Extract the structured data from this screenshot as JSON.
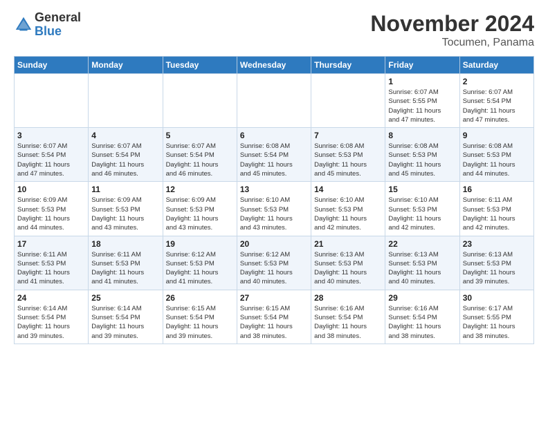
{
  "header": {
    "logo_line1": "General",
    "logo_line2": "Blue",
    "month_title": "November 2024",
    "location": "Tocumen, Panama"
  },
  "days_of_week": [
    "Sunday",
    "Monday",
    "Tuesday",
    "Wednesday",
    "Thursday",
    "Friday",
    "Saturday"
  ],
  "weeks": [
    [
      {
        "day": "",
        "content": ""
      },
      {
        "day": "",
        "content": ""
      },
      {
        "day": "",
        "content": ""
      },
      {
        "day": "",
        "content": ""
      },
      {
        "day": "",
        "content": ""
      },
      {
        "day": "1",
        "content": "Sunrise: 6:07 AM\nSunset: 5:55 PM\nDaylight: 11 hours\nand 47 minutes."
      },
      {
        "day": "2",
        "content": "Sunrise: 6:07 AM\nSunset: 5:54 PM\nDaylight: 11 hours\nand 47 minutes."
      }
    ],
    [
      {
        "day": "3",
        "content": "Sunrise: 6:07 AM\nSunset: 5:54 PM\nDaylight: 11 hours\nand 47 minutes."
      },
      {
        "day": "4",
        "content": "Sunrise: 6:07 AM\nSunset: 5:54 PM\nDaylight: 11 hours\nand 46 minutes."
      },
      {
        "day": "5",
        "content": "Sunrise: 6:07 AM\nSunset: 5:54 PM\nDaylight: 11 hours\nand 46 minutes."
      },
      {
        "day": "6",
        "content": "Sunrise: 6:08 AM\nSunset: 5:54 PM\nDaylight: 11 hours\nand 45 minutes."
      },
      {
        "day": "7",
        "content": "Sunrise: 6:08 AM\nSunset: 5:53 PM\nDaylight: 11 hours\nand 45 minutes."
      },
      {
        "day": "8",
        "content": "Sunrise: 6:08 AM\nSunset: 5:53 PM\nDaylight: 11 hours\nand 45 minutes."
      },
      {
        "day": "9",
        "content": "Sunrise: 6:08 AM\nSunset: 5:53 PM\nDaylight: 11 hours\nand 44 minutes."
      }
    ],
    [
      {
        "day": "10",
        "content": "Sunrise: 6:09 AM\nSunset: 5:53 PM\nDaylight: 11 hours\nand 44 minutes."
      },
      {
        "day": "11",
        "content": "Sunrise: 6:09 AM\nSunset: 5:53 PM\nDaylight: 11 hours\nand 43 minutes."
      },
      {
        "day": "12",
        "content": "Sunrise: 6:09 AM\nSunset: 5:53 PM\nDaylight: 11 hours\nand 43 minutes."
      },
      {
        "day": "13",
        "content": "Sunrise: 6:10 AM\nSunset: 5:53 PM\nDaylight: 11 hours\nand 43 minutes."
      },
      {
        "day": "14",
        "content": "Sunrise: 6:10 AM\nSunset: 5:53 PM\nDaylight: 11 hours\nand 42 minutes."
      },
      {
        "day": "15",
        "content": "Sunrise: 6:10 AM\nSunset: 5:53 PM\nDaylight: 11 hours\nand 42 minutes."
      },
      {
        "day": "16",
        "content": "Sunrise: 6:11 AM\nSunset: 5:53 PM\nDaylight: 11 hours\nand 42 minutes."
      }
    ],
    [
      {
        "day": "17",
        "content": "Sunrise: 6:11 AM\nSunset: 5:53 PM\nDaylight: 11 hours\nand 41 minutes."
      },
      {
        "day": "18",
        "content": "Sunrise: 6:11 AM\nSunset: 5:53 PM\nDaylight: 11 hours\nand 41 minutes."
      },
      {
        "day": "19",
        "content": "Sunrise: 6:12 AM\nSunset: 5:53 PM\nDaylight: 11 hours\nand 41 minutes."
      },
      {
        "day": "20",
        "content": "Sunrise: 6:12 AM\nSunset: 5:53 PM\nDaylight: 11 hours\nand 40 minutes."
      },
      {
        "day": "21",
        "content": "Sunrise: 6:13 AM\nSunset: 5:53 PM\nDaylight: 11 hours\nand 40 minutes."
      },
      {
        "day": "22",
        "content": "Sunrise: 6:13 AM\nSunset: 5:53 PM\nDaylight: 11 hours\nand 40 minutes."
      },
      {
        "day": "23",
        "content": "Sunrise: 6:13 AM\nSunset: 5:53 PM\nDaylight: 11 hours\nand 39 minutes."
      }
    ],
    [
      {
        "day": "24",
        "content": "Sunrise: 6:14 AM\nSunset: 5:54 PM\nDaylight: 11 hours\nand 39 minutes."
      },
      {
        "day": "25",
        "content": "Sunrise: 6:14 AM\nSunset: 5:54 PM\nDaylight: 11 hours\nand 39 minutes."
      },
      {
        "day": "26",
        "content": "Sunrise: 6:15 AM\nSunset: 5:54 PM\nDaylight: 11 hours\nand 39 minutes."
      },
      {
        "day": "27",
        "content": "Sunrise: 6:15 AM\nSunset: 5:54 PM\nDaylight: 11 hours\nand 38 minutes."
      },
      {
        "day": "28",
        "content": "Sunrise: 6:16 AM\nSunset: 5:54 PM\nDaylight: 11 hours\nand 38 minutes."
      },
      {
        "day": "29",
        "content": "Sunrise: 6:16 AM\nSunset: 5:54 PM\nDaylight: 11 hours\nand 38 minutes."
      },
      {
        "day": "30",
        "content": "Sunrise: 6:17 AM\nSunset: 5:55 PM\nDaylight: 11 hours\nand 38 minutes."
      }
    ]
  ]
}
